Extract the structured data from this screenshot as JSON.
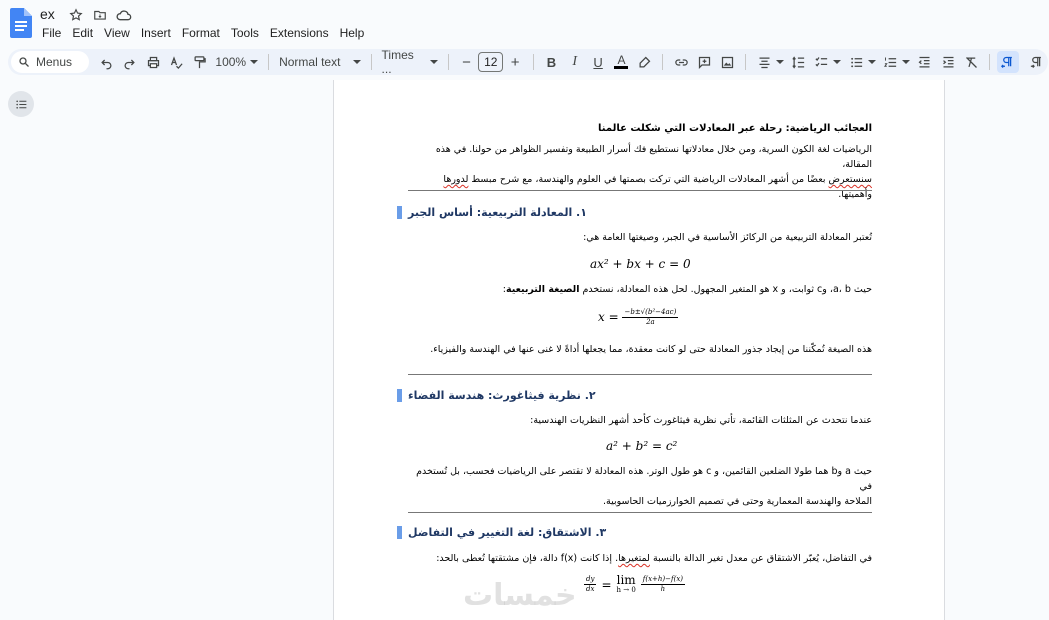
{
  "app": {
    "doc_title": "ex",
    "menus": [
      "File",
      "Edit",
      "View",
      "Insert",
      "Format",
      "Tools",
      "Extensions",
      "Help"
    ]
  },
  "toolbar": {
    "search_label": "Menus",
    "zoom": "100%",
    "style": "Normal text",
    "font": "Times ...",
    "font_size": "12",
    "minus": "−",
    "plus": "+",
    "bold": "B",
    "italic": "I",
    "underline": "U",
    "text_color": "A"
  },
  "doc": {
    "main_title": "العجائب الرياضية: رحلة عبر المعادلات التي شكلت عالمنا",
    "intro_1": "الرياضيات لغة الكون السرية، ومن خلال معادلاتها نستطيع فك أسرار الطبيعة وتفسير الظواهر من حولنا. في هذه المقالة،",
    "intro_2a": "سنستعرض",
    "intro_2b": " بعضًا من أشهر المعادلات الرياضية التي تركت بصمتها في العلوم والهندسة، مع شرح مبسط ",
    "intro_2c": "لدورها",
    "intro_2d": " وأهميتها.",
    "s1_heading": "١. المعادلة التربيعية: أساس الجبر",
    "s1_p1": "تُعتبر المعادلة التربيعية من الركائز الأساسية في الجبر، وصيغتها العامة هي:",
    "s1_eq": "ax² + bx + c = 0",
    "s1_p2a": "حيث a، b، وc ثوابت، و x هو المتغير المجهول. لحل هذه المعادلة، نستخدم ",
    "s1_p2b": "الصيغة التربيعية",
    "s1_p2c": ":",
    "s1_formula_lhs": "x =",
    "s1_formula_num": "−b±√(b²−4ac)",
    "s1_formula_den": "2a",
    "s1_p3": "هذه الصيغة تُمكّننا من إيجاد جذور المعادلة حتى لو كانت معقدة، مما يجعلها أداةً لا غنى عنها في الهندسة والفيزياء.",
    "s2_heading": "٢. نظرية فيثاغورث: هندسة الفضاء",
    "s2_p1": "عندما نتحدث عن المثلثات القائمة، تأتي نظرية فيثاغورث كأحد أشهر النظريات الهندسية:",
    "s2_eq": "a² + b² = c²",
    "s2_p2": "حيث a وb هما طولا الضلعين القائمين، و c هو طول الوتر. هذه المعادلة لا تقتصر على الرياضيات فحسب، بل تُستخدم في",
    "s2_p3": "الملاحة والهندسة المعمارية وحتى في تصميم الخوارزميات الحاسوبية.",
    "s3_heading": "٣. الاشتقاق: لغة التغيير في التفاضل",
    "s3_p1a": "في التفاضل، يُعبّر الاشتقاق عن معدل تغير الدالة بالنسبة ",
    "s3_p1b": "لمتغيرها",
    "s3_p1c": ". إذا كانت f(x) دالة، فإن مشتقتها تُعطى بالحد:",
    "s3_lhs_num": "dy",
    "s3_lhs_den": "dx",
    "s3_eq_sign": "=",
    "s3_lim": "lim",
    "s3_lim_sub": "h → 0",
    "s3_rhs_num": "f(x+h)−f(x)",
    "s3_rhs_den": "h"
  },
  "watermark": "خمسات",
  "colors": {
    "docs_blue": "#4285f4",
    "heading_color": "#1f3864",
    "heading_mark": "#6a9de8",
    "toolbar_bg": "#edf2fa"
  }
}
